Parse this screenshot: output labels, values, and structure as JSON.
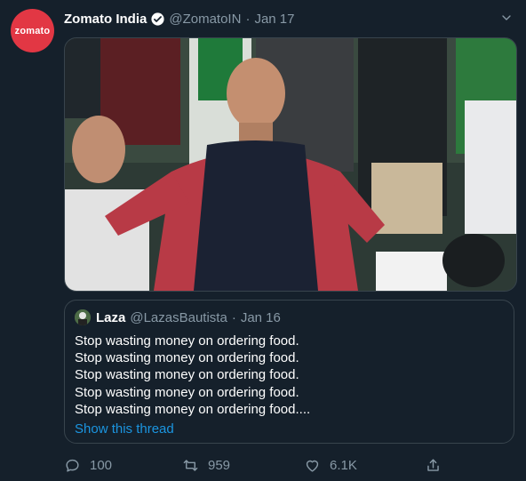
{
  "tweet": {
    "brand_logo_text": "zomato",
    "display_name": "Zomato India",
    "handle": "@ZomatoIN",
    "separator": "·",
    "date": "Jan 17",
    "icons": [
      "verified-badge-icon",
      "chevron-down-icon"
    ]
  },
  "quoted": {
    "display_name": "Laza",
    "handle": "@LazasBautista",
    "separator": "·",
    "date": "Jan 16",
    "lines": [
      "Stop wasting money on ordering food.",
      "Stop wasting money on ordering food.",
      "Stop wasting money on ordering food.",
      "Stop wasting money on ordering food.",
      "Stop wasting money on ordering food...."
    ],
    "show_thread": "Show this thread"
  },
  "actions": {
    "reply_count": "100",
    "retweet_count": "959",
    "like_count": "6.1K"
  },
  "colors": {
    "background": "#15202b",
    "border": "#38444d",
    "muted": "#8899a6",
    "link": "#1b95e0",
    "brand": "#e23744"
  }
}
